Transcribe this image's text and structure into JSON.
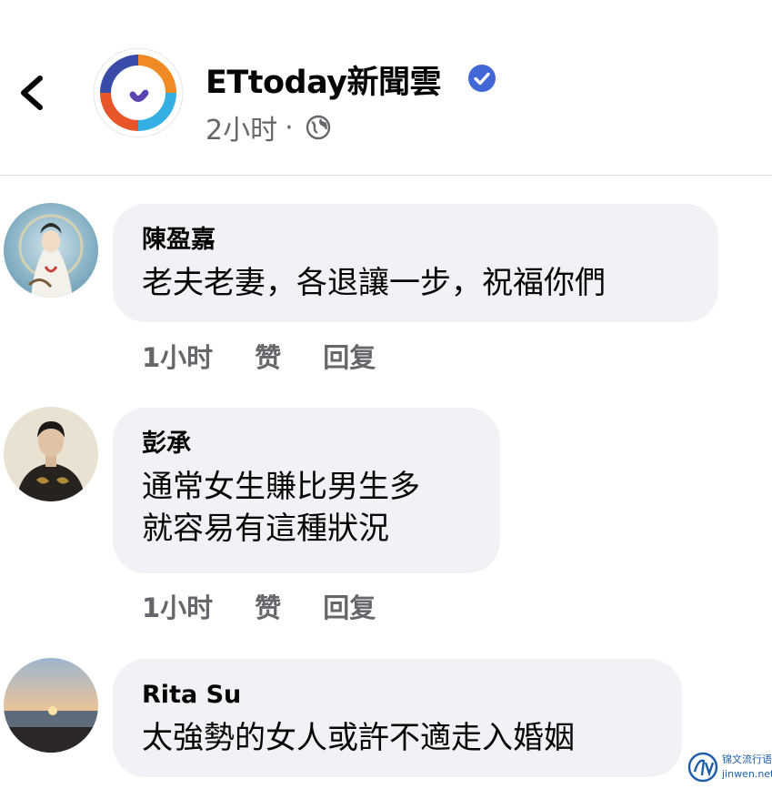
{
  "header": {
    "page_name": "ETtoday新聞雲",
    "post_time": "2小时",
    "separator": "·",
    "verified_color": "#4267d6"
  },
  "comments": [
    {
      "author": "陳盈嘉",
      "lines": [
        "老夫老妻，各退讓一步，祝福你們"
      ],
      "time": "1小时",
      "like_label": "赞",
      "reply_label": "回复"
    },
    {
      "author": "彭承",
      "lines": [
        "通常女生賺比男生多",
        "就容易有這種狀況"
      ],
      "time": "1小时",
      "like_label": "赞",
      "reply_label": "回复"
    },
    {
      "author": "Rita Su",
      "lines": [
        "太強勢的女人或許不適走入婚姻"
      ]
    }
  ],
  "watermark": {
    "line1": "锦文流行语",
    "line2": "jinwen.net"
  },
  "colors": {
    "bubble": "#f0f2f5",
    "muted_text": "#65676b",
    "text": "#050505"
  }
}
